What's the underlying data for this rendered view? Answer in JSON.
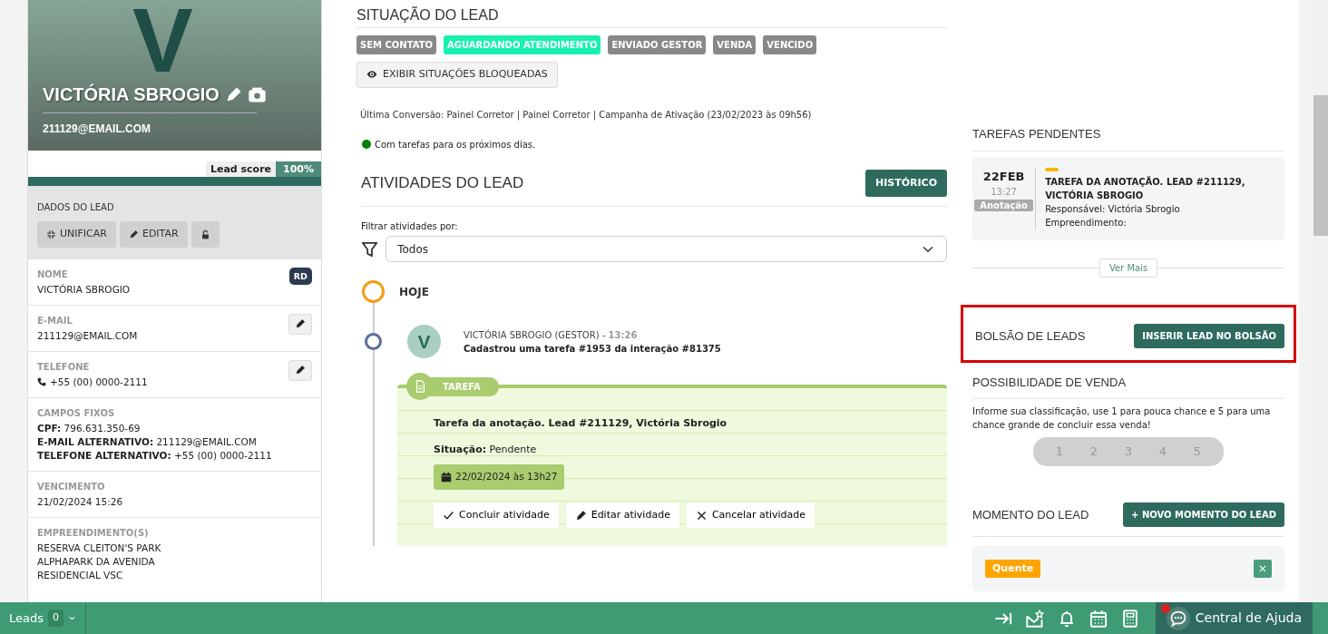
{
  "profile": {
    "banner_letter": "V",
    "name": "VICTÓRIA SBROGIO",
    "email": "211129@EMAIL.COM",
    "lead_score_label": "Lead score",
    "lead_score_value": "100%",
    "level": 1.0
  },
  "lead_data": {
    "title": "DADOS DO LEAD",
    "buttons": [
      {
        "kind": "merge",
        "label": "UNIFICAR"
      },
      {
        "kind": "edit",
        "label": "EDITAR"
      },
      {
        "kind": "lock"
      }
    ]
  },
  "fields": [
    {
      "kind": "text",
      "label": "NOME",
      "value": "VICTÓRIA SBROGIO",
      "badge": "RD"
    },
    {
      "kind": "text",
      "label": "E-MAIL",
      "value": "211129@EMAIL.COM",
      "editable": true
    },
    {
      "kind": "phone",
      "label": "TELEFONE",
      "value": "+55 (00) 0000-2111",
      "editable": true
    },
    {
      "kind": "pairs",
      "label": "CAMPOS FIXOS",
      "pairs": [
        {
          "key": "CPF:",
          "value": "796.631.350-69"
        },
        {
          "key": "E-MAIL ALTERNATIVO:",
          "value": "211129@EMAIL.COM"
        },
        {
          "key": "TELEFONE ALTERNATIVO:",
          "value": "+55 (00) 0000-2111"
        }
      ]
    },
    {
      "kind": "text",
      "label": "VENCIMENTO",
      "value": "21/02/2024 15:26"
    },
    {
      "kind": "lines",
      "label": "EMPREENDIMENTO(S)",
      "lines": [
        "RESERVA CLEITON'S PARK",
        "ALPHAPARK DA AVENIDA",
        "RESIDENCIAL VSC"
      ]
    }
  ],
  "situation": {
    "title": "SITUAÇÃO DO LEAD",
    "statuses": [
      {
        "label": "SEM CONTATO",
        "selected": false
      },
      {
        "label": "AGUARDANDO ATENDIMENTO",
        "selected": true
      },
      {
        "label": "ENVIADO GESTOR",
        "selected": false
      },
      {
        "label": "VENDA",
        "selected": false
      },
      {
        "label": "VENCIDO",
        "selected": false
      }
    ],
    "show_blocked_button": "EXIBIR SITUAÇÕES BLOQUEADAS",
    "last_conversion": "Última Conversão: Painel Corretor | Painel Corretor | Campanha de Ativação (23/02/2023 às 09h56)",
    "task_status": {
      "text": "Com tarefas para os próximos dias.",
      "color": "#008000"
    }
  },
  "activities": {
    "title": "ATIVIDADES DO LEAD",
    "history_button": "HISTÓRICO",
    "filter_label": "Filtrar atividades por:",
    "filter_value": "Todos",
    "timeline": [
      {
        "kind": "day",
        "label": "HOJE"
      },
      {
        "kind": "entry",
        "avatar": "V",
        "author": "VICTÓRIA SBROGIO (GESTOR) -",
        "time": "13:26",
        "summary": "Cadastrou uma tarefa #1953 da interação #81375",
        "card": {
          "tag": "TAREFA",
          "title": "Tarefa da anotação. Lead #211129, Victória Sbrogio",
          "status": "**Situação:** Pendente",
          "due": "22/02/2024 às 13h27",
          "actions": [
            {
              "kind": "complete",
              "label": "Concluir atividade"
            },
            {
              "kind": "edit",
              "label": "Editar atividade"
            },
            {
              "kind": "cancel",
              "label": "Cancelar atividade"
            }
          ]
        }
      }
    ]
  },
  "pending_tasks": {
    "title": "TAREFAS PENDENTES",
    "tasks": [
      {
        "day": "22FEB",
        "time": "13:27",
        "type": "Anotação",
        "color": "#f5b800",
        "title": "TAREFA DA ANOTAÇÃO. LEAD #211129, VICTÓRIA SBROGIO",
        "responsible": "Responsável: Victória Sbrogio",
        "development": "Empreendimento:"
      }
    ],
    "more_button": "Ver Mais"
  },
  "lead_pool": {
    "title": "BOLSÃO DE LEADS",
    "button": "INSERIR LEAD NO BOLSÃO",
    "highlighted": true
  },
  "sale_chance": {
    "title": "POSSIBILIDADE DE VENDA",
    "hint": "Informe sua classificação, use 1 para pouca chance e 5 para uma chance grande de concluir essa venda!",
    "options": [
      {
        "label": "1",
        "selected": false
      },
      {
        "label": "2",
        "selected": false
      },
      {
        "label": "3",
        "selected": false
      },
      {
        "label": "4",
        "selected": false
      },
      {
        "label": "5",
        "selected": false
      }
    ]
  },
  "lead_moment": {
    "title": "MOMENTO DO LEAD",
    "button": "+ NOVO MOMENTO DO LEAD",
    "tags": [
      {
        "label": "Quente",
        "color": "#ffa500"
      }
    ]
  },
  "bottom_bar": {
    "leads_label": "Leads",
    "leads_count": "0",
    "help_label": "Central de Ajuda",
    "help_notification": true
  }
}
